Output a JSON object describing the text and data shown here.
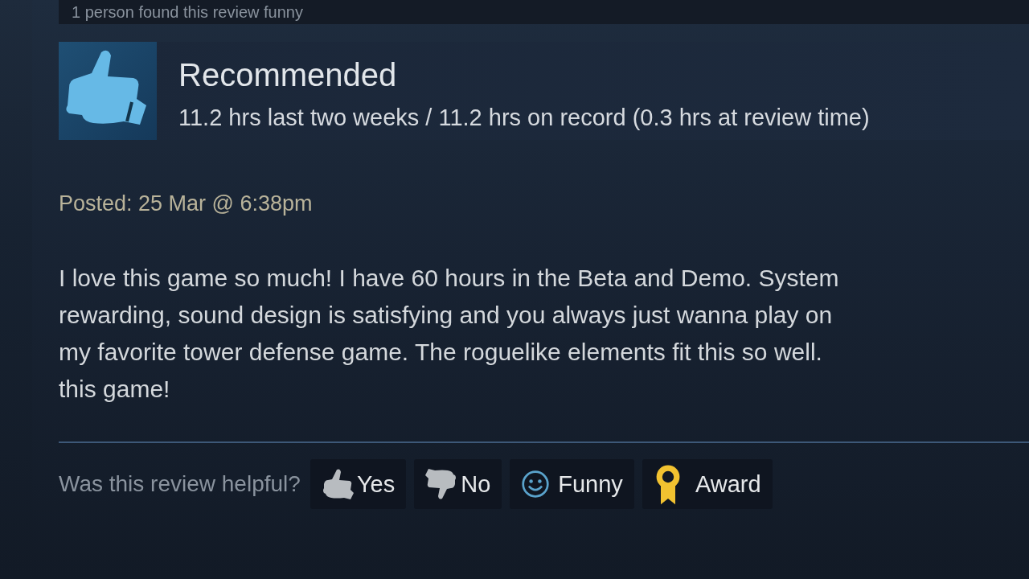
{
  "funny_count": "1 person found this review funny",
  "recommendation": {
    "recommended": true,
    "title": "Recommended",
    "hours": "11.2 hrs last two weeks / 11.2 hrs on record (0.3 hrs at review time)"
  },
  "posted": "Posted: 25 Mar @ 6:38pm",
  "review_lines": [
    "I love this game so much! I have 60 hours in the Beta and Demo. System",
    "rewarding, sound design is satisfying and you always just wanna play on",
    "my favorite tower defense game. The roguelike elements fit this so well.",
    "this game!"
  ],
  "helpful_prompt": "Was this review helpful?",
  "buttons": [
    {
      "kind": "yes",
      "label": "Yes"
    },
    {
      "kind": "no",
      "label": "No"
    },
    {
      "kind": "funny",
      "label": "Funny"
    },
    {
      "kind": "award",
      "label": "Award"
    }
  ]
}
